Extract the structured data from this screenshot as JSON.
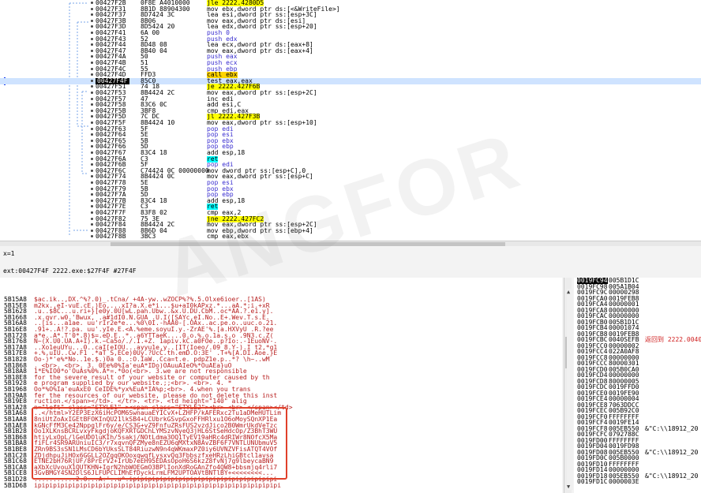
{
  "disasm": {
    "rows": [
      {
        "addr": "00427F2B",
        "bytes": "0F8E A4010000",
        "instr": "jle 2222.4280D5",
        "kind": "jmp"
      },
      {
        "addr": "00427F31",
        "bytes": "8B1D 88904300",
        "instr": "mov ebx,dword ptr ds:[<&WriteFile>]",
        "kind": "mov"
      },
      {
        "addr": "00427F37",
        "bytes": "8D7424 3C",
        "instr": "lea esi,dword ptr ss:[esp+3C]",
        "kind": "mov"
      },
      {
        "addr": "00427F3B",
        "bytes": "8B06",
        "instr": "mov eax,dword ptr ds:[esi]",
        "kind": "mov"
      },
      {
        "addr": "00427F3D",
        "bytes": "8D5424 20",
        "instr": "lea edx,dword ptr ss:[esp+20]",
        "kind": "mov"
      },
      {
        "addr": "00427F41",
        "bytes": "6A 00",
        "instr": "push 0",
        "kind": "push"
      },
      {
        "addr": "00427F43",
        "bytes": "52",
        "instr": "push edx",
        "kind": "push"
      },
      {
        "addr": "00427F44",
        "bytes": "8D48 08",
        "instr": "lea ecx,dword ptr ds:[eax+8]",
        "kind": "mov"
      },
      {
        "addr": "00427F47",
        "bytes": "8B40 04",
        "instr": "mov eax,dword ptr ds:[eax+4]",
        "kind": "mov"
      },
      {
        "addr": "00427F4A",
        "bytes": "50",
        "instr": "push eax",
        "kind": "push"
      },
      {
        "addr": "00427F4B",
        "bytes": "51",
        "instr": "push ecx",
        "kind": "push"
      },
      {
        "addr": "00427F4C",
        "bytes": "55",
        "instr": "push ebp",
        "kind": "push"
      },
      {
        "addr": "00427F4D",
        "bytes": "FFD3",
        "instr": "call ebx",
        "kind": "call"
      },
      {
        "addr": "00427F4F",
        "bytes": "85C0",
        "instr": "test eax,eax",
        "kind": "sel"
      },
      {
        "addr": "00427F51",
        "bytes": "74 18",
        "instr": "je 2222.427F6B",
        "kind": "jmp"
      },
      {
        "addr": "00427F53",
        "bytes": "8B4424 2C",
        "instr": "mov eax,dword ptr ss:[esp+2C]",
        "kind": "mov"
      },
      {
        "addr": "00427F57",
        "bytes": "47",
        "instr": "inc edi",
        "kind": "mov"
      },
      {
        "addr": "00427F58",
        "bytes": "83C6 0C",
        "instr": "add esi,C",
        "kind": "mov"
      },
      {
        "addr": "00427F5B",
        "bytes": "3BF8",
        "instr": "cmp edi,eax",
        "kind": "mov"
      },
      {
        "addr": "00427F5D",
        "bytes": "7C DC",
        "instr": "jl 2222.427F3B",
        "kind": "jmp"
      },
      {
        "addr": "00427F5F",
        "bytes": "8B4424 10",
        "instr": "mov eax,dword ptr ss:[esp+10]",
        "kind": "mov"
      },
      {
        "addr": "00427F63",
        "bytes": "5F",
        "instr": "pop edi",
        "kind": "push"
      },
      {
        "addr": "00427F64",
        "bytes": "5E",
        "instr": "pop esi",
        "kind": "push"
      },
      {
        "addr": "00427F65",
        "bytes": "5B",
        "instr": "pop ebx",
        "kind": "push"
      },
      {
        "addr": "00427F66",
        "bytes": "5D",
        "instr": "pop ebp",
        "kind": "push"
      },
      {
        "addr": "00427F67",
        "bytes": "83C4 18",
        "instr": "add esp,18",
        "kind": "mov"
      },
      {
        "addr": "00427F6A",
        "bytes": "C3",
        "instr": "ret",
        "kind": "ret"
      },
      {
        "addr": "00427F6B",
        "bytes": "5F",
        "instr": "pop edi",
        "kind": "push"
      },
      {
        "addr": "00427F6C",
        "bytes": "C74424 0C 00000000",
        "instr": "mov dword ptr ss:[esp+C],0",
        "kind": "mov"
      },
      {
        "addr": "00427F74",
        "bytes": "8B4424 0C",
        "instr": "mov eax,dword ptr ss:[esp+C]",
        "kind": "mov"
      },
      {
        "addr": "00427F78",
        "bytes": "5E",
        "instr": "pop esi",
        "kind": "push"
      },
      {
        "addr": "00427F79",
        "bytes": "5B",
        "instr": "pop ebx",
        "kind": "push"
      },
      {
        "addr": "00427F7A",
        "bytes": "5D",
        "instr": "pop ebp",
        "kind": "push"
      },
      {
        "addr": "00427F7B",
        "bytes": "83C4 18",
        "instr": "add esp,18",
        "kind": "mov"
      },
      {
        "addr": "00427F7E",
        "bytes": "C3",
        "instr": "ret",
        "kind": "ret"
      },
      {
        "addr": "00427F7F",
        "bytes": "83F8 02",
        "instr": "cmp eax,2",
        "kind": "mov"
      },
      {
        "addr": "00427F82",
        "bytes": "75 3E",
        "instr": "jne 2222.427FC2",
        "kind": "jmp"
      },
      {
        "addr": "00427F84",
        "bytes": "8B4424 2C",
        "instr": "mov eax,dword ptr ss:[esp+2C]",
        "kind": "mov"
      },
      {
        "addr": "00427F88",
        "bytes": "8B6D 04",
        "instr": "mov ebp,dword ptr ss:[ebp+4]",
        "kind": "mov"
      },
      {
        "addr": "00427F8B",
        "bytes": "3BC3",
        "instr": "cmp eax,ebx",
        "kind": "mov"
      }
    ]
  },
  "status": {
    "line1": "x=1",
    "line2": "ext:00427F4F 2222.exe:$27F4F #27F4F"
  },
  "dump": {
    "rows": [
      {
        "addr": "5B15A8",
        "text": "$ac.ik..,DX.^%?.0)_.tCna/ +4A-yw..wZOCP%?%.5.Olxe6ioer..[1AS)"
      },
      {
        "addr": "5B15E8",
        "text": "m2kx.,eI-vuE.cE.)Eo,...xI?a.X.e*i...$u+aI0kAPxz.*...aA.*;i.+xR"
      },
      {
        "addr": "5B1628",
        "text": ".u..$8C...u.ri+}[e0y.0U[wL.pah.Ubw..&x.U.DU.CbM..oc*AA.?.e1.y]."
      },
      {
        "addr": "5B1668",
        "text": ".x.qvr.w0.'Bwux,  .a#1dI0.N.GUA .U.I([SAYc,eI.No..E+.Wev.T.s.E."
      },
      {
        "addr": "5B16A8",
        "text": "..[is...a1ae. uu'rIr2e*e...%0\\0I.-hAA0-[.OAx..ac.pe.o..uuc.o.21."
      },
      {
        "addr": "5B16E8",
        "text": ".91+..A!?.pa. uu'.yIe.E.<A.%eme.soyuI.y.-ZrAE'%.[a.HXVyU .R.?ee"
      },
      {
        "addr": "5B1728",
        "text": "a*e..A*.T'0*.8)$=.eD.E..*..a6YTTaeK....0.o.%.o.1a.s.o .9N3.c.Z("
      },
      {
        "addr": "5B1768",
        "text": "N~(X.U0.UA.A+I).k.~Ca5o/./.I.+Z. 1apiv.kC.a0FOe..p?Io:.-1EuoNV-."
      },
      {
        "addr": "5B17A8",
        "text": "..Xo1euUYu...0..caI[eIOU...ayyu1e,y..[IT(Ioeo/.09 8.Y-).I  t2,*g1"
      },
      {
        "addr": "5B17E8",
        "text": "+.%,uIU..Cw.F1 .*aT_S,ECe)0Uy.?UcC.th.emD.O:3E' .T+%[A.DI.Aoe.}E"
      },
      {
        "addr": "5B1828",
        "text": "Oo-)*'e%*No..1e.$.)0a 0..:O.IaW..Cca=t.e. pdpZ1e.p..*? \\h~..wM"
      },
      {
        "addr": "5B1868",
        "text": ". <br>.        <br>.        3. 0Ee%0%Ia'euA*IDo)OAuuAIeO%*OuAEa}uO"
      },
      {
        "addr": "5B18A8",
        "text": "1*E%IO0*o'OuAs%0%.A*=.*0o(<br>.    3.we are not responsible"
      },
      {
        "addr": "5B18E8",
        "text": "for the  severe result of your website or computer caused by th"
      },
      {
        "addr": "5B1928",
        "text": "e program  supplied by our website.;;<br>.      <br>.      4. *"
      },
      {
        "addr": "5B1968",
        "text": "Oo*%O%Ia'euAxE0 CeIDE%*yx%EuA*IA%p;<br>.     4.when you  trans"
      },
      {
        "addr": "5B19A8",
        "text": "fer the resources of our website, please do not delete this inst"
      },
      {
        "addr": "5B19E8",
        "text": "ruction.</span></td>.  </tr>.  <tr>.    <td height=\"140\" alig"
      },
      {
        "addr": "5B1A28",
        "text": "n=\"left\" class=\"STYLE1\" ><span class=\"STYLE2\"><br> <br>  </span></td>"
      },
      {
        "addr": "5B1A68",
        "text": "..</html>Y2EP3EzX6iHcPOM6SwnauaEYICvX+LZHFP/kAFERxc2Tu1aDMeHUTLim"
      },
      {
        "addr": "5B1AA8",
        "text": "8niUtZoAxIGEtBFOKInQU21lkSB4+LCUbrkGSvpGxoFFHRlxu1O6oMoySQnXP1Ea"
      },
      {
        "addr": "5B1AE8",
        "text": "kGNcFfM3Ce42NppglFr6y/e/CS3G+vZ9FnfuZRsFUS2vzdJico2B0WmrUkdVeTzc"
      },
      {
        "addr": "5B1B28",
        "text": "Oo1XLKnsBCRLvxyFkgdjoKQFXRTGDChLYMSzvNyeQ3jHL6StSeHdcOp/Z3BhT3WU"
      },
      {
        "addr": "5B1B68",
        "text": "htiyLxOpL/lGeUDOluKIh/5sakj/NOtLdma3OQ1TyEV19aHRc4dRIWr8NOfcX5Ma"
      },
      {
        "addr": "5B1BA8",
        "text": "fiFLr4SR9ARUniuIC3/r7xqvnQFZMye8nEZU6qMXtxN8AvZBF6F7VNTLUNUbmuV5"
      },
      {
        "addr": "5B1BE8",
        "text": "ZRn9BS3sSN1LMsCD6bYUksSLT84RiuzwN9n4qWKmaxPZ0iy6UVNZVFisATQT4VOf"
      },
      {
        "addr": "5B1C28",
        "text": "ZDjdhpuJiHOx6GGLL2OZgqOKOoxqwqfLysxvQq3FbbszfxeHRzLhiGBtcl1avsa"
      },
      {
        "addr": "5B1C68",
        "text": "ETNE2bH76RjUF/8PrErV2+IrUb7eEH95EDAsOpoH6S6kzZ8fvNj7g9lbeycaBN9"
      },
      {
        "addr": "5B1CA8",
        "text": "aXbXcUvouX1QUTKHN+IgrN2hbWOEGmO3BPlIonXdRoGAnZfo4QW8+bbsmjq4rli7"
      },
      {
        "addr": "5B1CE8",
        "text": "3GvBMGY4SN2DlS6JLFUPCLIMhEfDyckLrmLFM2UPTOAVtBNTlBY+<<<<<<<<..."
      },
      {
        "addr": "5B1D28",
        "text": "...........2.0...A:'..u^.ipipipipipipipipipipipipipipipipipipipi"
      },
      {
        "addr": "5B1D68",
        "text": "ipipipipipipipipipipipipipipipipipipipipipipipipipipipipipipipipi"
      }
    ]
  },
  "stack": {
    "rows": [
      {
        "addr": "0019FC94",
        "val": "005B1D1C",
        "cmt": "",
        "hl": true
      },
      {
        "addr": "0019FC98",
        "val": "005A1B04",
        "cmt": ""
      },
      {
        "addr": "0019FC9C",
        "val": "00000298",
        "cmt": ""
      },
      {
        "addr": "0019FCA0",
        "val": "0019FEB8",
        "cmt": ""
      },
      {
        "addr": "0019FCA4",
        "val": "00000001",
        "cmt": ""
      },
      {
        "addr": "0019FCA8",
        "val": "00000000",
        "cmt": ""
      },
      {
        "addr": "0019FCAC",
        "val": "00000000",
        "cmt": ""
      },
      {
        "addr": "0019FCB0",
        "val": "005B1D1C",
        "cmt": ""
      },
      {
        "addr": "0019FCB4",
        "val": "00001074",
        "cmt": ""
      },
      {
        "addr": "0019FCB8",
        "val": "0019FEB8",
        "cmt": ""
      },
      {
        "addr": "0019FCBC",
        "val": "0040SEFB",
        "cmt": "返回到 2222.0040",
        "red": true
      },
      {
        "addr": "0019FCC0",
        "val": "00000002",
        "cmt": ""
      },
      {
        "addr": "0019FCC4",
        "val": "022A0AF8",
        "cmt": ""
      },
      {
        "addr": "0019FCC8",
        "val": "00000000",
        "cmt": ""
      },
      {
        "addr": "0019FCCC",
        "val": "80000301",
        "cmt": ""
      },
      {
        "addr": "0019FCD0",
        "val": "005B0CA0",
        "cmt": ""
      },
      {
        "addr": "0019FCD4",
        "val": "00000000",
        "cmt": ""
      },
      {
        "addr": "0019FCD8",
        "val": "80000005",
        "cmt": ""
      },
      {
        "addr": "0019FCDC",
        "val": "0019FFD0",
        "cmt": ""
      },
      {
        "addr": "0019FCE0",
        "val": "0019FE90",
        "cmt": ""
      },
      {
        "addr": "0019FCE4",
        "val": "00000004",
        "cmt": ""
      },
      {
        "addr": "0019FCE8",
        "val": "7063DDCC",
        "cmt": ""
      },
      {
        "addr": "0019FCEC",
        "val": "005B92C0",
        "cmt": ""
      },
      {
        "addr": "0019FCF0",
        "val": "FFFFFFFF",
        "cmt": ""
      },
      {
        "addr": "0019FCF4",
        "val": "0019FE14",
        "cmt": ""
      },
      {
        "addr": "0019FCF8",
        "val": "005EB550",
        "cmt": "&\"C:\\\\18912_20"
      },
      {
        "addr": "0019FCFC",
        "val": "0792788C",
        "cmt": ""
      },
      {
        "addr": "0019FD00",
        "val": "FFFFFFFF",
        "cmt": ""
      },
      {
        "addr": "0019FD04",
        "val": "0019FD98",
        "cmt": ""
      },
      {
        "addr": "0019FD08",
        "val": "005EB550",
        "cmt": "&\"C:\\\\18912_20"
      },
      {
        "addr": "0019FD0C",
        "val": "005B0000",
        "cmt": ""
      },
      {
        "addr": "0019FD10",
        "val": "FFFFFFFF",
        "cmt": ""
      },
      {
        "addr": "0019FD14",
        "val": "00000000",
        "cmt": ""
      },
      {
        "addr": "0019FD18",
        "val": "005EB550",
        "cmt": "&\"C:\\\\18912_20"
      },
      {
        "addr": "0019FD1C",
        "val": "0000003E",
        "cmt": ""
      }
    ]
  },
  "watermark": "ANGFOR"
}
